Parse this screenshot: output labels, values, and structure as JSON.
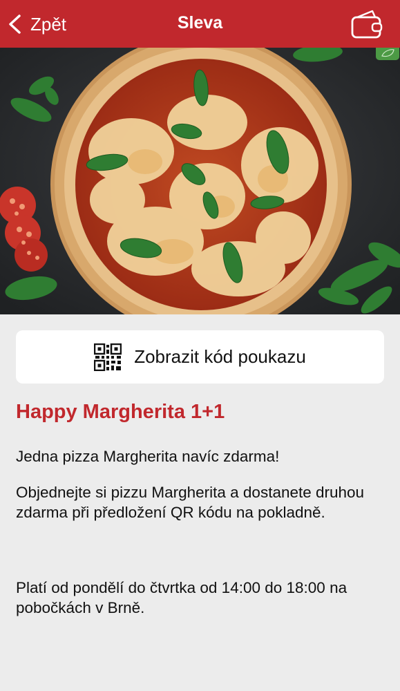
{
  "navbar": {
    "back_label": "Zpět",
    "title": "Sleva",
    "back_icon": "chevron-left-icon",
    "wallet_icon": "wallet-icon",
    "color": "#c1282d"
  },
  "hero": {
    "image": "margherita-pizza-photo"
  },
  "voucher": {
    "button_label": "Zobrazit kód poukazu",
    "icon": "qr-code-icon"
  },
  "promo": {
    "title": "Happy Margherita 1+1",
    "tagline": "Jedna pizza Margherita navíc zdarma!",
    "description": "Objednejte si pizzu Margherita a dostanete druhou zdarma při předložení QR kódu na pokladně.",
    "validity": "Platí od pondělí do čtvrtka od 14:00 do 18:00 na pobočkách v Brně."
  }
}
